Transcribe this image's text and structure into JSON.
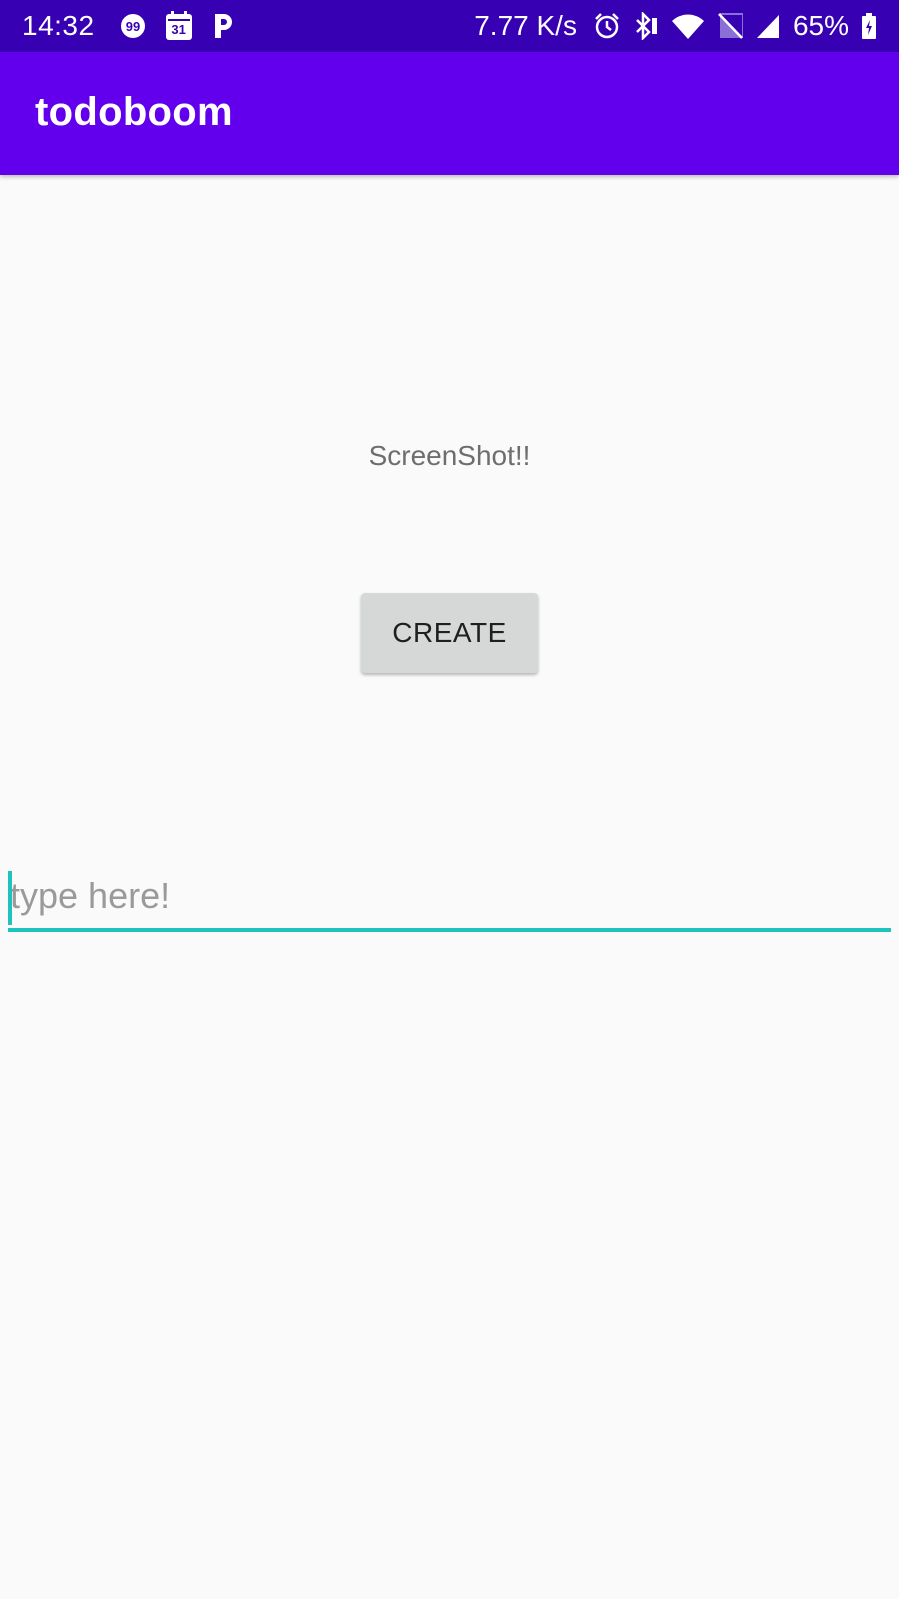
{
  "status_bar": {
    "time": "14:32",
    "left_icons": [
      "notification-99-icon",
      "calendar-icon",
      "parking-app-icon"
    ],
    "calendar_day": "31",
    "speed": "7.77 K/s",
    "right_icons": [
      "alarm-icon",
      "bluetooth-icon",
      "wifi-icon",
      "no-sim-icon",
      "signal-icon",
      "battery-charging-icon"
    ],
    "battery": "65%",
    "color": "#3700b3"
  },
  "app_bar": {
    "title": "todoboom",
    "color": "#6200ee"
  },
  "main": {
    "message": "ScreenShot!!",
    "create_label": "CREATE",
    "input": {
      "value": "",
      "placeholder": "type here!",
      "accent_color": "#1fc3bd"
    }
  }
}
